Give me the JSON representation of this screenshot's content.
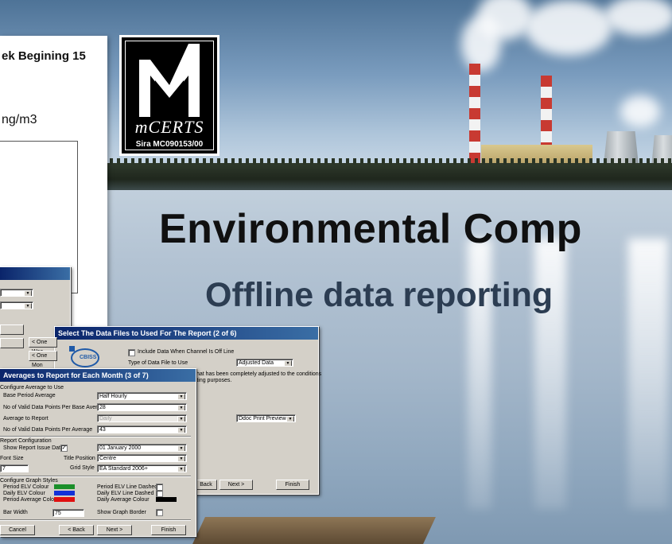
{
  "document": {
    "heading": "ek Begining 15",
    "unit": "ng/m3"
  },
  "logo": {
    "brand": "mCERTS",
    "code": "Sira MC090153/00"
  },
  "headline": "Environmental Comp",
  "subhead": "Offline data reporting",
  "dialog_back": {
    "buttons": [
      "< One Wee",
      "< One Mon"
    ]
  },
  "dialog_files": {
    "title": "Select The Data Files to Used For The Report (2 of 6)",
    "logo_text": "CBISS",
    "include_offline_label": "Include Data When Channel Is Off Line",
    "file_type_label": "Type of Data File to Use",
    "file_type_value": "Adjusted Data",
    "description_line1": "that has been completely adjusted to the conditions",
    "description_line2": "rting purposes.",
    "previewer_value": "Ddoc Print Previewer",
    "back_label": "Back",
    "next_label": "Next >",
    "finish_label": "Finish"
  },
  "dialog_averages": {
    "title": "Averages to Report for Each Month (3 of 7)",
    "section_average": "Configure Average to Use",
    "base_period_label": "Base Period Average",
    "base_period_value": "Half Hourly",
    "valid_points_base_label": "No of Valid Data Points Per Base Average",
    "valid_points_base_value": "28",
    "average_report_label": "Average to Report",
    "average_report_value": "Daily",
    "valid_points_avg_label": "No of Valid Data Points Per Average",
    "valid_points_avg_value": "43",
    "section_report": "Report Configuration",
    "show_issue_date_label": "Show Report Issue Date",
    "issue_date_value": "01  January  2000",
    "font_size_label": "Font Size",
    "font_size_value": "7",
    "title_position_label": "Title Position",
    "title_position_value": "Centre",
    "grid_style_label": "Grid Style",
    "grid_style_value": "EA Standard 2006+",
    "section_graph": "Configure Graph Styles",
    "period_elv_colour_label": "Period ELV Colour",
    "daily_elv_colour_label": "Daily ELV Colour",
    "period_avg_colour_label": "Period Average Colour",
    "period_elv_dashed_label": "Period ELV Line Dashed",
    "daily_elv_dashed_label": "Daily ELV Line Dashed",
    "daily_avg_colour_label": "Daily Average Colour",
    "bar_width_label": "Bar Width",
    "bar_width_value": "75",
    "show_border_label": "Show Graph Border",
    "cancel_label": "Cancel",
    "back_label": "< Back",
    "next_label": "Next >",
    "finish_label": "Finish"
  },
  "colors": {
    "period_elv": "#1b8f2a",
    "daily_elv": "#1230d8",
    "period_avg": "#e01010",
    "daily_avg": "#000000"
  }
}
